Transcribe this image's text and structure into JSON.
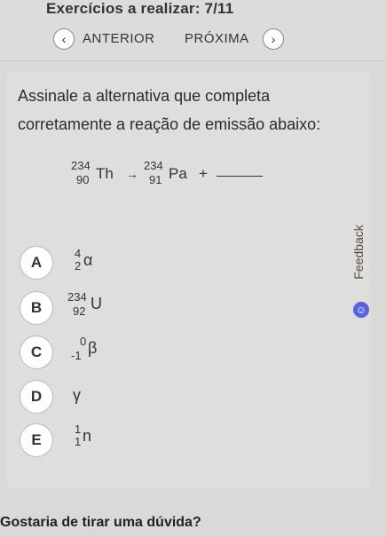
{
  "header": {
    "title": "Exercícios a realizar: 7/11"
  },
  "nav": {
    "prev_icon": "chevron-left-icon",
    "prev_glyph": "‹",
    "prev_label": "ANTERIOR",
    "next_label": "PRÓXIMA",
    "next_icon": "chevron-right-icon",
    "next_glyph": "›"
  },
  "question": {
    "text": "Assinale a alternativa que completa corretamente a reação de emissão abaixo:",
    "reaction": {
      "reactant": {
        "mass": "234",
        "atomic": "90",
        "symbol": "Th"
      },
      "arrow": "→",
      "product": {
        "mass": "234",
        "atomic": "91",
        "symbol": "Pa"
      },
      "plus": "+"
    }
  },
  "options": [
    {
      "letter": "A",
      "mass": "4",
      "atomic": "2",
      "symbol": "α"
    },
    {
      "letter": "B",
      "mass": "234",
      "atomic": "92",
      "symbol": "U"
    },
    {
      "letter": "C",
      "mass": "0",
      "atomic": "-1",
      "symbol": "β"
    },
    {
      "letter": "D",
      "mass": "",
      "atomic": "",
      "symbol": "γ"
    },
    {
      "letter": "E",
      "mass": "1",
      "atomic": "1",
      "symbol": "n"
    }
  ],
  "feedback": {
    "label": "Feedback",
    "icon": "smile-icon",
    "icon_glyph": "☺",
    "icon_color": "#5b62e0"
  },
  "footer": {
    "text": "Gostaria de tirar uma dúvida?"
  }
}
